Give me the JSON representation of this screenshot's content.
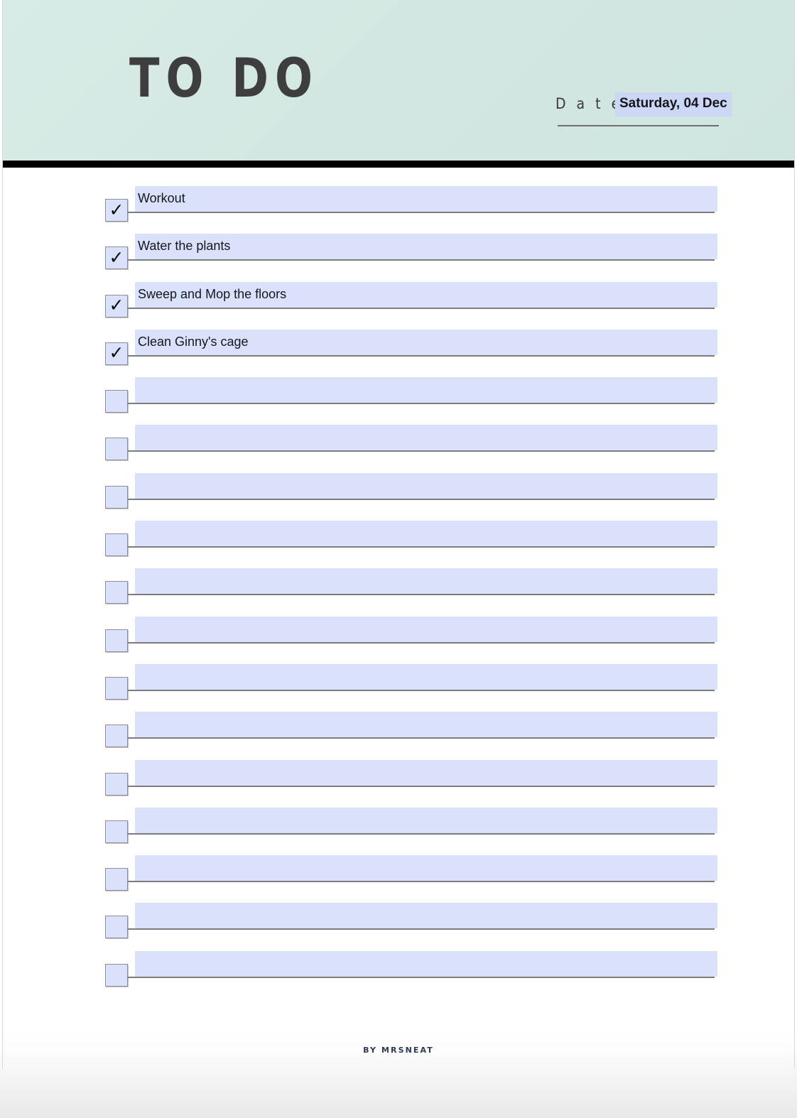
{
  "header": {
    "title": "TO DO",
    "date_label": "D a t e :",
    "date_value": "Saturday, 04 Dec"
  },
  "colors": {
    "header_mint": "#d3e7e2",
    "divider_black": "#000000",
    "field_periwinkle": "#d9e1fb",
    "underline_gray": "#7c7c7c",
    "title_text": "#3e3e3e",
    "body_text": "#17171c",
    "footer_text": "#2e3a4f"
  },
  "list": {
    "check_glyph": "✓",
    "rows": [
      {
        "text": "Workout",
        "checked": true
      },
      {
        "text": "Water the plants",
        "checked": true
      },
      {
        "text": "Sweep and Mop the floors",
        "checked": true
      },
      {
        "text": "Clean Ginny's cage",
        "checked": true
      },
      {
        "text": "",
        "checked": false
      },
      {
        "text": "",
        "checked": false
      },
      {
        "text": "",
        "checked": false
      },
      {
        "text": "",
        "checked": false
      },
      {
        "text": "",
        "checked": false
      },
      {
        "text": "",
        "checked": false
      },
      {
        "text": "",
        "checked": false
      },
      {
        "text": "",
        "checked": false
      },
      {
        "text": "",
        "checked": false
      },
      {
        "text": "",
        "checked": false
      },
      {
        "text": "",
        "checked": false
      },
      {
        "text": "",
        "checked": false
      },
      {
        "text": "",
        "checked": false
      }
    ]
  },
  "footer": {
    "credit": "BY MRSNEAT"
  }
}
